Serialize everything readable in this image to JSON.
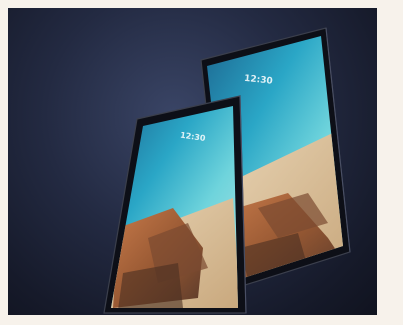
{
  "image": {
    "background_color": "#f7f2eb",
    "scene_color": "#1c2236"
  },
  "tablets": [
    {
      "label": "large-tablet",
      "lock_time": "12:30"
    },
    {
      "label": "small-tablet",
      "lock_time": "12:30"
    }
  ]
}
